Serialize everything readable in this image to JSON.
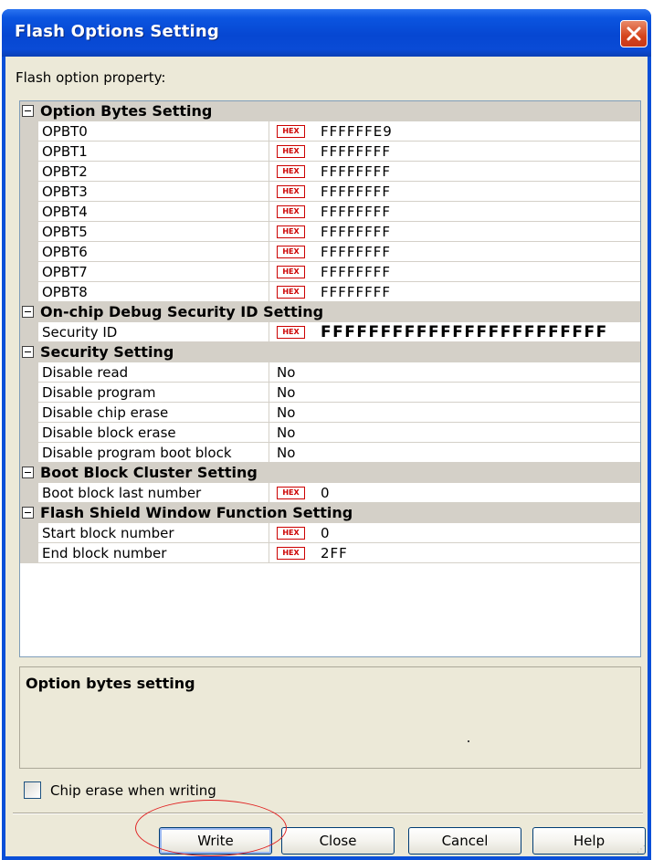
{
  "window": {
    "title": "Flash Options Setting"
  },
  "caption": "Flash option property:",
  "hex_badge": "HEX",
  "categories": [
    {
      "label": "Option Bytes Setting"
    },
    {
      "label": "On-chip Debug Security ID Setting"
    },
    {
      "label": "Security Setting"
    },
    {
      "label": "Boot Block Cluster Setting"
    },
    {
      "label": "Flash Shield Window Function Setting"
    }
  ],
  "properties": {
    "opbt0": {
      "name": "OPBT0",
      "value": "FFFFFFE9"
    },
    "opbt1": {
      "name": "OPBT1",
      "value": "FFFFFFFF"
    },
    "opbt2": {
      "name": "OPBT2",
      "value": "FFFFFFFF"
    },
    "opbt3": {
      "name": "OPBT3",
      "value": "FFFFFFFF"
    },
    "opbt4": {
      "name": "OPBT4",
      "value": "FFFFFFFF"
    },
    "opbt5": {
      "name": "OPBT5",
      "value": "FFFFFFFF"
    },
    "opbt6": {
      "name": "OPBT6",
      "value": "FFFFFFFF"
    },
    "opbt7": {
      "name": "OPBT7",
      "value": "FFFFFFFF"
    },
    "opbt8": {
      "name": "OPBT8",
      "value": "FFFFFFFF"
    },
    "security_id": {
      "name": "Security ID",
      "value": "FFFFFFFFFFFFFFFFFFFFFFFF"
    },
    "disable_read": {
      "name": "Disable read",
      "value": "No"
    },
    "disable_program": {
      "name": "Disable program",
      "value": "No"
    },
    "disable_chip_erase": {
      "name": "Disable chip erase",
      "value": "No"
    },
    "disable_block_erase": {
      "name": "Disable block erase",
      "value": "No"
    },
    "disable_program_boot_block": {
      "name": "Disable program boot block",
      "value": "No"
    },
    "boot_block_last_number": {
      "name": "Boot block last number",
      "value": "0"
    },
    "start_block_number": {
      "name": "Start block number",
      "value": "0"
    },
    "end_block_number": {
      "name": "End block number",
      "value": "2FF"
    }
  },
  "description": {
    "title": "Option bytes setting"
  },
  "chip_erase": {
    "label": "Chip erase when writing",
    "checked": false
  },
  "buttons": {
    "write": "Write",
    "close": "Close",
    "cancel": "Cancel",
    "help": "Help"
  },
  "colors": {
    "title_bar": "#0a4bd6",
    "hex_badge": "#cc0000",
    "annotation_ring": "#e02020"
  }
}
